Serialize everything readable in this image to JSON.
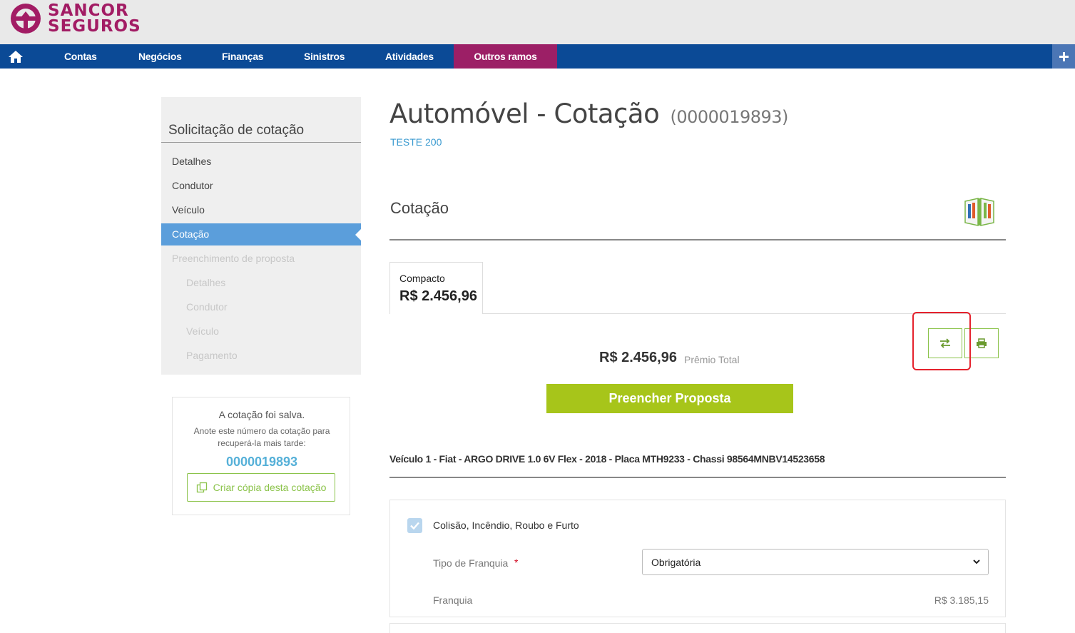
{
  "brand": {
    "line1": "SANCOR",
    "line2": "SEGUROS",
    "color": "#a21c64"
  },
  "nav": {
    "home_icon": "home-icon",
    "items": [
      "Contas",
      "Negócios",
      "Finanças",
      "Sinistros",
      "Atividades",
      "Outros ramos"
    ],
    "plus_icon": "plus-icon",
    "bar_color": "#0b4a96",
    "active_color": "#9c1f66"
  },
  "sidebar": {
    "title": "Solicitação de cotação",
    "items": [
      {
        "label": "Detalhes",
        "state": "normal"
      },
      {
        "label": "Condutor",
        "state": "normal"
      },
      {
        "label": "Veículo",
        "state": "normal"
      },
      {
        "label": "Cotação",
        "state": "active"
      },
      {
        "label": "Preenchimento de proposta",
        "state": "disabled"
      },
      {
        "label": "Detalhes",
        "state": "disabled-sub"
      },
      {
        "label": "Condutor",
        "state": "disabled-sub"
      },
      {
        "label": "Veículo",
        "state": "disabled-sub"
      },
      {
        "label": "Pagamento",
        "state": "disabled-sub"
      }
    ]
  },
  "saved": {
    "title": "A cotação foi salva.",
    "note": "Anote este número da cotação para recuperá-la mais tarde:",
    "number": "0000019893",
    "copy_button": "Criar cópia desta cotação"
  },
  "main": {
    "title": "Automóvel - Cotação",
    "quote_number": "(0000019893)",
    "client": "TESTE 200",
    "section": "Cotação",
    "guide_icon": "open-book-guide-icon"
  },
  "plan": {
    "name": "Compacto",
    "price": "R$ 2.456,96"
  },
  "actions": {
    "compare_icon": "swap-arrows-icon",
    "print_icon": "printer-icon"
  },
  "total": {
    "price": "R$ 2.456,96",
    "label": "Prêmio Total"
  },
  "primary_button": "Preencher Proposta",
  "vehicle": "Veículo 1 - Fiat - ARGO DRIVE 1.0 6V Flex - 2018 - Placa MTH9233 - Chassi 98564MNBV14523658",
  "coverage": {
    "label": "Colisão, Incêndio, Roubo e Furto",
    "checked": true,
    "franquia_type_label": "Tipo de Franquia",
    "required_mark": "*",
    "franquia_type_value": "Obrigatória",
    "franquia_label": "Franquia",
    "franquia_value": "R$ 3.185,15"
  }
}
